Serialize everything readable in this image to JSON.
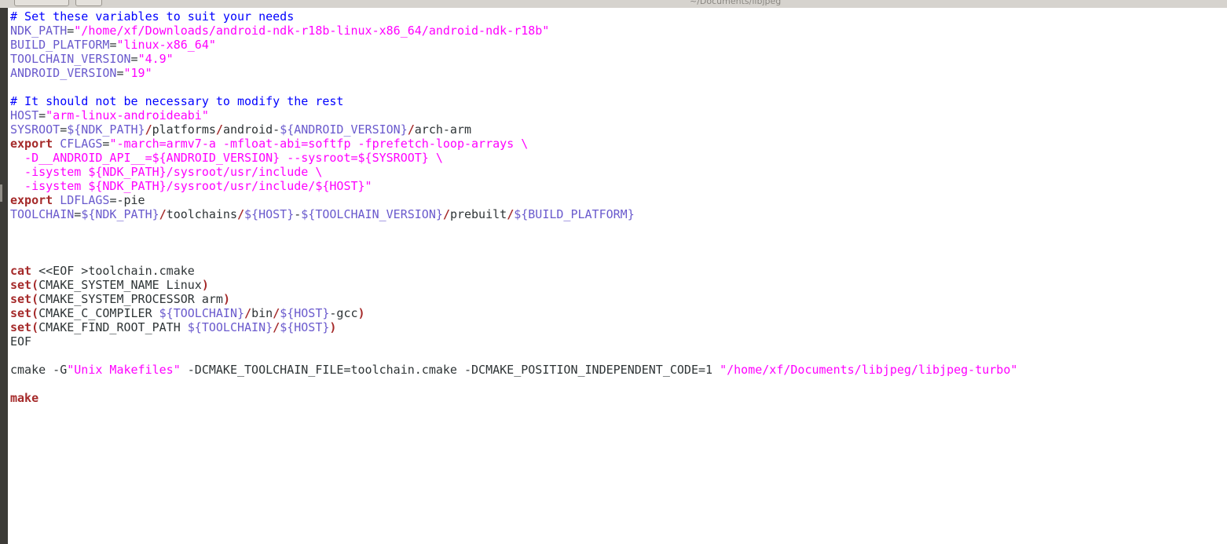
{
  "window": {
    "title": "~/Documents/libjpeg"
  },
  "colors": {
    "comment": "#0000ff",
    "variable": "#6a5acd",
    "string": "#ff00ff",
    "keyword": "#a52a2a",
    "text": "#2e3436",
    "background": "#ffffff",
    "left_bar": "#3c3b37"
  },
  "editor": {
    "lines": [
      [
        {
          "t": "# Set these variables to suit your needs",
          "c": "comment"
        }
      ],
      [
        {
          "t": "NDK_PATH",
          "c": "var"
        },
        {
          "t": "=",
          "c": "text"
        },
        {
          "t": "\"/home/xf/Downloads/android-ndk-r18b-linux-x86_64/android-ndk-r18b\"",
          "c": "str"
        }
      ],
      [
        {
          "t": "BUILD_PLATFORM",
          "c": "var"
        },
        {
          "t": "=",
          "c": "text"
        },
        {
          "t": "\"linux-x86_64\"",
          "c": "str"
        }
      ],
      [
        {
          "t": "TOOLCHAIN_VERSION",
          "c": "var"
        },
        {
          "t": "=",
          "c": "text"
        },
        {
          "t": "\"4.9\"",
          "c": "str"
        }
      ],
      [
        {
          "t": "ANDROID_VERSION",
          "c": "var"
        },
        {
          "t": "=",
          "c": "text"
        },
        {
          "t": "\"19\"",
          "c": "str"
        }
      ],
      [],
      [
        {
          "t": "# It should not be necessary to modify the rest",
          "c": "comment"
        }
      ],
      [
        {
          "t": "HOST",
          "c": "var"
        },
        {
          "t": "=",
          "c": "text"
        },
        {
          "t": "\"arm-linux-androideabi\"",
          "c": "str"
        }
      ],
      [
        {
          "t": "SYSROOT",
          "c": "var"
        },
        {
          "t": "=",
          "c": "text"
        },
        {
          "t": "${NDK_PATH}",
          "c": "var"
        },
        {
          "t": "/",
          "c": "op"
        },
        {
          "t": "platforms",
          "c": "text"
        },
        {
          "t": "/",
          "c": "op"
        },
        {
          "t": "android-",
          "c": "text"
        },
        {
          "t": "${ANDROID_VERSION}",
          "c": "var"
        },
        {
          "t": "/",
          "c": "op"
        },
        {
          "t": "arch-arm",
          "c": "text"
        }
      ],
      [
        {
          "t": "export",
          "c": "kw"
        },
        {
          "t": " ",
          "c": "text"
        },
        {
          "t": "CFLAGS",
          "c": "var"
        },
        {
          "t": "=",
          "c": "text"
        },
        {
          "t": "\"-march=armv7-a -mfloat-abi=softfp -fprefetch-loop-arrays \\",
          "c": "str"
        }
      ],
      [
        {
          "t": "  -D__ANDROID_API__=${ANDROID_VERSION} --sysroot=${SYSROOT} \\",
          "c": "str"
        }
      ],
      [
        {
          "t": "  -isystem ${NDK_PATH}/sysroot/usr/include \\",
          "c": "str"
        }
      ],
      [
        {
          "t": "  -isystem ${NDK_PATH}/sysroot/usr/include/${HOST}\"",
          "c": "str"
        }
      ],
      [
        {
          "t": "export",
          "c": "kw"
        },
        {
          "t": " ",
          "c": "text"
        },
        {
          "t": "LDFLAGS",
          "c": "var"
        },
        {
          "t": "=-pie",
          "c": "text"
        }
      ],
      [
        {
          "t": "TOOLCHAIN",
          "c": "var"
        },
        {
          "t": "=",
          "c": "text"
        },
        {
          "t": "${NDK_PATH}",
          "c": "var"
        },
        {
          "t": "/",
          "c": "op"
        },
        {
          "t": "toolchains",
          "c": "text"
        },
        {
          "t": "/",
          "c": "op"
        },
        {
          "t": "${HOST}",
          "c": "var"
        },
        {
          "t": "-",
          "c": "text"
        },
        {
          "t": "${TOOLCHAIN_VERSION}",
          "c": "var"
        },
        {
          "t": "/",
          "c": "op"
        },
        {
          "t": "prebuilt",
          "c": "text"
        },
        {
          "t": "/",
          "c": "op"
        },
        {
          "t": "${BUILD_PLATFORM}",
          "c": "var"
        }
      ],
      [],
      [],
      [],
      [
        {
          "t": "cat",
          "c": "kw"
        },
        {
          "t": " <<EOF >toolchain.cmake",
          "c": "text"
        }
      ],
      [
        {
          "t": "set",
          "c": "kw"
        },
        {
          "t": "(",
          "c": "op"
        },
        {
          "t": "CMAKE_SYSTEM_NAME Linux",
          "c": "text"
        },
        {
          "t": ")",
          "c": "op"
        }
      ],
      [
        {
          "t": "set",
          "c": "kw"
        },
        {
          "t": "(",
          "c": "op"
        },
        {
          "t": "CMAKE_SYSTEM_PROCESSOR arm",
          "c": "text"
        },
        {
          "t": ")",
          "c": "op"
        }
      ],
      [
        {
          "t": "set",
          "c": "kw"
        },
        {
          "t": "(",
          "c": "op"
        },
        {
          "t": "CMAKE_C_COMPILER ",
          "c": "text"
        },
        {
          "t": "${TOOLCHAIN}",
          "c": "var"
        },
        {
          "t": "/",
          "c": "op"
        },
        {
          "t": "bin",
          "c": "text"
        },
        {
          "t": "/",
          "c": "op"
        },
        {
          "t": "${HOST}",
          "c": "var"
        },
        {
          "t": "-gcc",
          "c": "text"
        },
        {
          "t": ")",
          "c": "op"
        }
      ],
      [
        {
          "t": "set",
          "c": "kw"
        },
        {
          "t": "(",
          "c": "op"
        },
        {
          "t": "CMAKE_FIND_ROOT_PATH ",
          "c": "text"
        },
        {
          "t": "${TOOLCHAIN}",
          "c": "var"
        },
        {
          "t": "/",
          "c": "op"
        },
        {
          "t": "${HOST}",
          "c": "var"
        },
        {
          "t": ")",
          "c": "op"
        }
      ],
      [
        {
          "t": "EOF",
          "c": "text"
        }
      ],
      [],
      [
        {
          "t": "cmake -G",
          "c": "text"
        },
        {
          "t": "\"Unix Makefiles\"",
          "c": "str"
        },
        {
          "t": " -DCMAKE_TOOLCHAIN_FILE=toolchain.cmake -DCMAKE_POSITION_INDEPENDENT_CODE=1 ",
          "c": "text"
        },
        {
          "t": "\"/home/xf/Documents/libjpeg/libjpeg-turbo\"",
          "c": "str"
        }
      ],
      [],
      [
        {
          "t": "make",
          "c": "kw"
        }
      ]
    ]
  }
}
